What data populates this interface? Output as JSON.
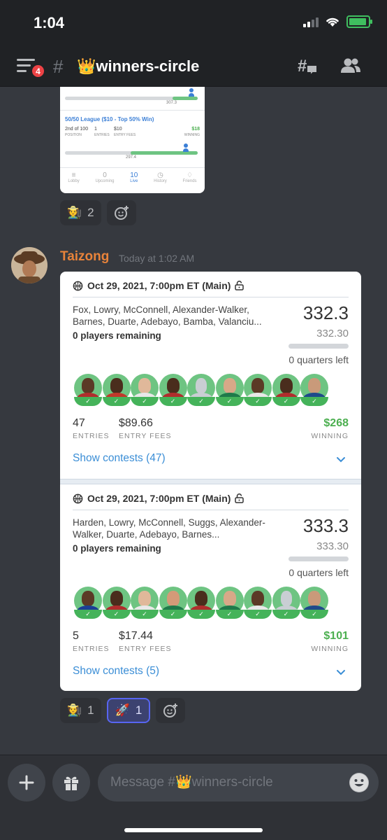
{
  "status_bar": {
    "time": "1:04"
  },
  "header": {
    "menu_badge": "4",
    "channel_hash": "#",
    "channel_name": "👑winners-circle"
  },
  "top_embed": {
    "league_label": "50/50 League ($10 - Top 50% Win)",
    "position_value": "2nd of 100",
    "position_label": "POSITION",
    "entries_value": "1",
    "entries_label": "ENTRIES",
    "fee_value": "$10",
    "fee_label": "ENTRY FEES",
    "winning_value": "$18",
    "winning_label": "WINNING",
    "pts_a": "307.3",
    "pts_b": "297.4",
    "tabs": [
      {
        "icon": "≡",
        "label": "Lobby"
      },
      {
        "icon": "0",
        "label": "Upcoming"
      },
      {
        "icon": "10",
        "label": "Live"
      },
      {
        "icon": "◷",
        "label": "History"
      },
      {
        "icon": "♢",
        "label": "Friends"
      }
    ]
  },
  "reactions_top": [
    {
      "emoji": "🧑‍🌾",
      "count": "2"
    }
  ],
  "message": {
    "author": "Taizong",
    "timestamp": "Today at 1:02 AM"
  },
  "cards": [
    {
      "title": "Oct 29, 2021, 7:00pm ET (Main)",
      "players": "Fox, Lowry, McConnell, Alexander-Walker, Barnes, Duarte, Adebayo, Bamba, Valanciu...",
      "remaining": "0 players remaining",
      "score": "332.3",
      "score_sub": "332.30",
      "progress": 0,
      "quarters": "0 quarters left",
      "entries_value": "47",
      "entries_label": "ENTRIES",
      "fees_value": "$89.66",
      "fees_label": "ENTRY FEES",
      "winning_value": "$268",
      "winning_label": "WINNING",
      "show_label": "Show contests (47)"
    },
    {
      "title": "Oct 29, 2021, 7:00pm ET (Main)",
      "players": "Harden, Lowry, McConnell, Suggs, Alexander-Walker, Duarte, Adebayo, Barnes...",
      "remaining": "0 players remaining",
      "score": "333.3",
      "score_sub": "333.30",
      "progress": 0,
      "quarters": "0 quarters left",
      "entries_value": "5",
      "entries_label": "ENTRIES",
      "fees_value": "$17.44",
      "fees_label": "ENTRY FEES",
      "winning_value": "$101",
      "winning_label": "WINNING",
      "show_label": "Show contests (5)"
    }
  ],
  "reactions_bottom": [
    {
      "emoji": "🧑‍🌾",
      "count": "1"
    },
    {
      "emoji": "🚀",
      "count": "1"
    }
  ],
  "composer": {
    "placeholder": "Message #👑winners-circle"
  },
  "colors": {
    "background": "#36393f",
    "header": "#202225",
    "accent": "#5865f2",
    "author": "#e8833a",
    "winning": "#4caf50",
    "link": "#3b8ed6"
  }
}
